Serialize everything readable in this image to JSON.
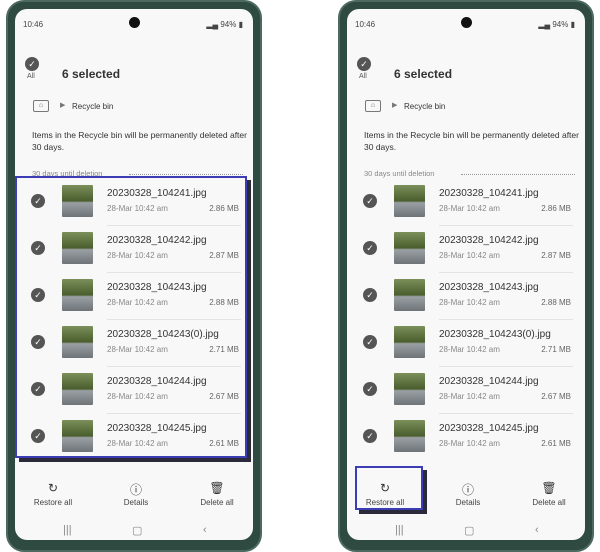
{
  "status": {
    "time": "10:46",
    "battery": "94%"
  },
  "header": {
    "title": "6 selected",
    "all_label": "All"
  },
  "breadcrumb": {
    "folder_icon": "home-folder-icon",
    "label": "Recycle bin"
  },
  "notice": "Items in the Recycle bin will be permanently deleted after 30 days.",
  "section": "30 days until deletion",
  "files": [
    {
      "name": "20230328_104241.jpg",
      "date": "28-Mar 10:42 am",
      "size": "2.86 MB"
    },
    {
      "name": "20230328_104242.jpg",
      "date": "28-Mar 10:42 am",
      "size": "2.87 MB"
    },
    {
      "name": "20230328_104243.jpg",
      "date": "28-Mar 10:42 am",
      "size": "2.88 MB"
    },
    {
      "name": "20230328_104243(0).jpg",
      "date": "28-Mar 10:42 am",
      "size": "2.71 MB"
    },
    {
      "name": "20230328_104244.jpg",
      "date": "28-Mar 10:42 am",
      "size": "2.67 MB"
    },
    {
      "name": "20230328_104245.jpg",
      "date": "28-Mar 10:42 am",
      "size": "2.61 MB"
    }
  ],
  "actions": {
    "restore": "Restore all",
    "details": "Details",
    "delete": "Delete all"
  },
  "highlight_color": "#3c3cb5"
}
